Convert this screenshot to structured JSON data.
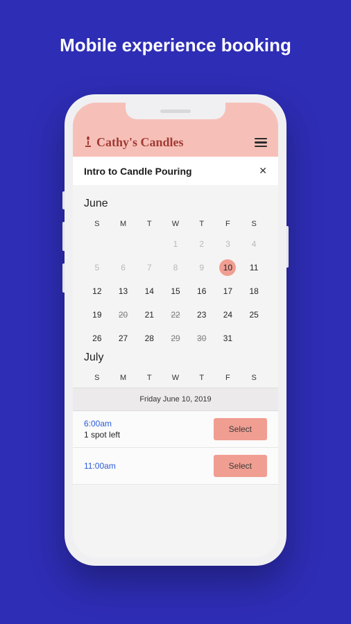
{
  "page_title": "Mobile experience booking",
  "header": {
    "brand": "Cathy's Candles"
  },
  "booking": {
    "title": "Intro to Candle Pouring",
    "selected_date_label": "Friday June 10, 2019"
  },
  "weekday_labels": [
    "S",
    "M",
    "T",
    "W",
    "T",
    "F",
    "S"
  ],
  "months": [
    {
      "name": "June",
      "weeks": [
        [
          {
            "n": "",
            "cls": ""
          },
          {
            "n": "",
            "cls": ""
          },
          {
            "n": "",
            "cls": ""
          },
          {
            "n": "1",
            "cls": "muted"
          },
          {
            "n": "2",
            "cls": "muted"
          },
          {
            "n": "3",
            "cls": "muted"
          },
          {
            "n": "4",
            "cls": "muted"
          }
        ],
        [
          {
            "n": "5",
            "cls": "muted"
          },
          {
            "n": "6",
            "cls": "muted"
          },
          {
            "n": "7",
            "cls": "muted"
          },
          {
            "n": "8",
            "cls": "muted"
          },
          {
            "n": "9",
            "cls": "muted"
          },
          {
            "n": "10",
            "cls": "selected"
          },
          {
            "n": "11",
            "cls": ""
          }
        ],
        [
          {
            "n": "12",
            "cls": ""
          },
          {
            "n": "13",
            "cls": ""
          },
          {
            "n": "14",
            "cls": ""
          },
          {
            "n": "15",
            "cls": ""
          },
          {
            "n": "16",
            "cls": ""
          },
          {
            "n": "17",
            "cls": ""
          },
          {
            "n": "18",
            "cls": ""
          }
        ],
        [
          {
            "n": "19",
            "cls": ""
          },
          {
            "n": "20",
            "cls": "strike"
          },
          {
            "n": "21",
            "cls": ""
          },
          {
            "n": "22",
            "cls": "strike"
          },
          {
            "n": "23",
            "cls": ""
          },
          {
            "n": "24",
            "cls": ""
          },
          {
            "n": "25",
            "cls": ""
          }
        ],
        [
          {
            "n": "26",
            "cls": ""
          },
          {
            "n": "27",
            "cls": ""
          },
          {
            "n": "28",
            "cls": ""
          },
          {
            "n": "29",
            "cls": "strike"
          },
          {
            "n": "30",
            "cls": "strike"
          },
          {
            "n": "31",
            "cls": ""
          },
          {
            "n": "",
            "cls": ""
          }
        ]
      ]
    },
    {
      "name": "July",
      "weeks": []
    }
  ],
  "slots": [
    {
      "time": "6:00am",
      "note": "1 spot left",
      "button": "Select"
    },
    {
      "time": "11:00am",
      "note": "",
      "button": "Select"
    }
  ]
}
